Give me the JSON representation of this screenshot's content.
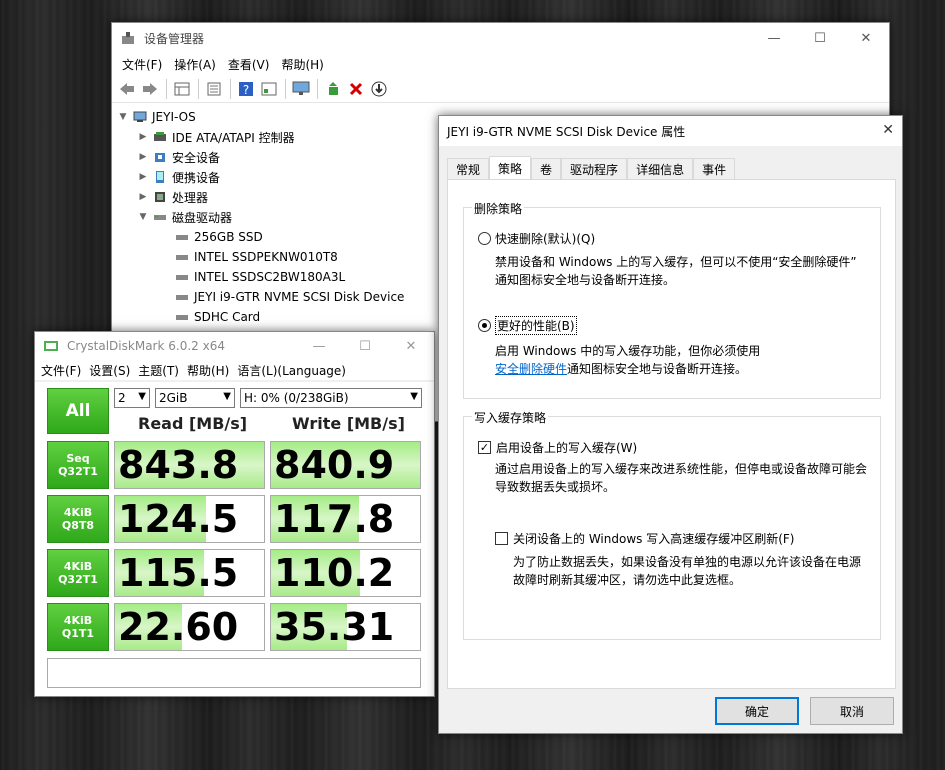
{
  "device_manager": {
    "title": "设备管理器",
    "menu": [
      "文件(F)",
      "操作(A)",
      "查看(V)",
      "帮助(H)"
    ],
    "tree": {
      "root": "JEYI-OS",
      "categories": [
        "IDE ATA/ATAPI 控制器",
        "安全设备",
        "便携设备",
        "处理器",
        "磁盘驱动器"
      ],
      "disks": [
        "256GB SSD",
        "INTEL SSDPEKNW010T8",
        "INTEL SSDSC2BW180A3L",
        "JEYI i9-GTR NVME SCSI Disk Device",
        "SDHC Card"
      ]
    }
  },
  "crystaldiskmark": {
    "title": "CrystalDiskMark 6.0.2 x64",
    "menu": [
      "文件(F)",
      "设置(S)",
      "主题(T)",
      "帮助(H)",
      "语言(L)(Language)"
    ],
    "all_label": "All",
    "count": "2",
    "size": "2GiB",
    "drive": "H: 0% (0/238GiB)",
    "read_header": "Read [MB/s]",
    "write_header": "Write [MB/s]",
    "rows": [
      {
        "line1": "Seq",
        "line2": "Q32T1",
        "read": "843.8",
        "write": "840.9",
        "read_fill": 1.0,
        "write_fill": 1.0
      },
      {
        "line1": "4KiB",
        "line2": "Q8T8",
        "read": "124.5",
        "write": "117.8",
        "read_fill": 0.61,
        "write_fill": 0.59
      },
      {
        "line1": "4KiB",
        "line2": "Q32T1",
        "read": "115.5",
        "write": "110.2",
        "read_fill": 0.6,
        "write_fill": 0.6
      },
      {
        "line1": "4KiB",
        "line2": "Q1T1",
        "read": "22.60",
        "write": "35.31",
        "read_fill": 0.45,
        "write_fill": 0.51
      }
    ]
  },
  "properties": {
    "title": "JEYI i9-GTR NVME SCSI Disk Device 属性",
    "tabs": [
      "常规",
      "策略",
      "卷",
      "驱动程序",
      "详细信息",
      "事件"
    ],
    "active_tab": "策略",
    "removal_group": "删除策略",
    "quick_removal": "快速删除(默认)(Q)",
    "quick_desc_1": "禁用设备和 Windows 上的写入缓存，但可以不使用“安全删除硬件”",
    "quick_desc_2": "通知图标安全地与设备断开连接。",
    "better_perf": "更好的性能(B)",
    "better_desc_1": "启用 Windows 中的写入缓存功能，但你必须使用",
    "better_desc_link": "安全删除硬件",
    "better_desc_2": "通知图标安全地与设备断开连接。",
    "cache_group": "写入缓存策略",
    "enable_cache": "启用设备上的写入缓存(W)",
    "enable_desc_1": "通过启用设备上的写入缓存来改进系统性能，但停电或设备故障可能会",
    "enable_desc_2": "导致数据丢失或损坏。",
    "flush_off": "关闭设备上的 Windows 写入高速缓存缓冲区刷新(F)",
    "flush_desc_1": "为了防止数据丢失，如果设备没有单独的电源以允许该设备在电源",
    "flush_desc_2": "故障时刷新其缓冲区，请勿选中此复选框。",
    "ok": "确定",
    "cancel": "取消"
  }
}
